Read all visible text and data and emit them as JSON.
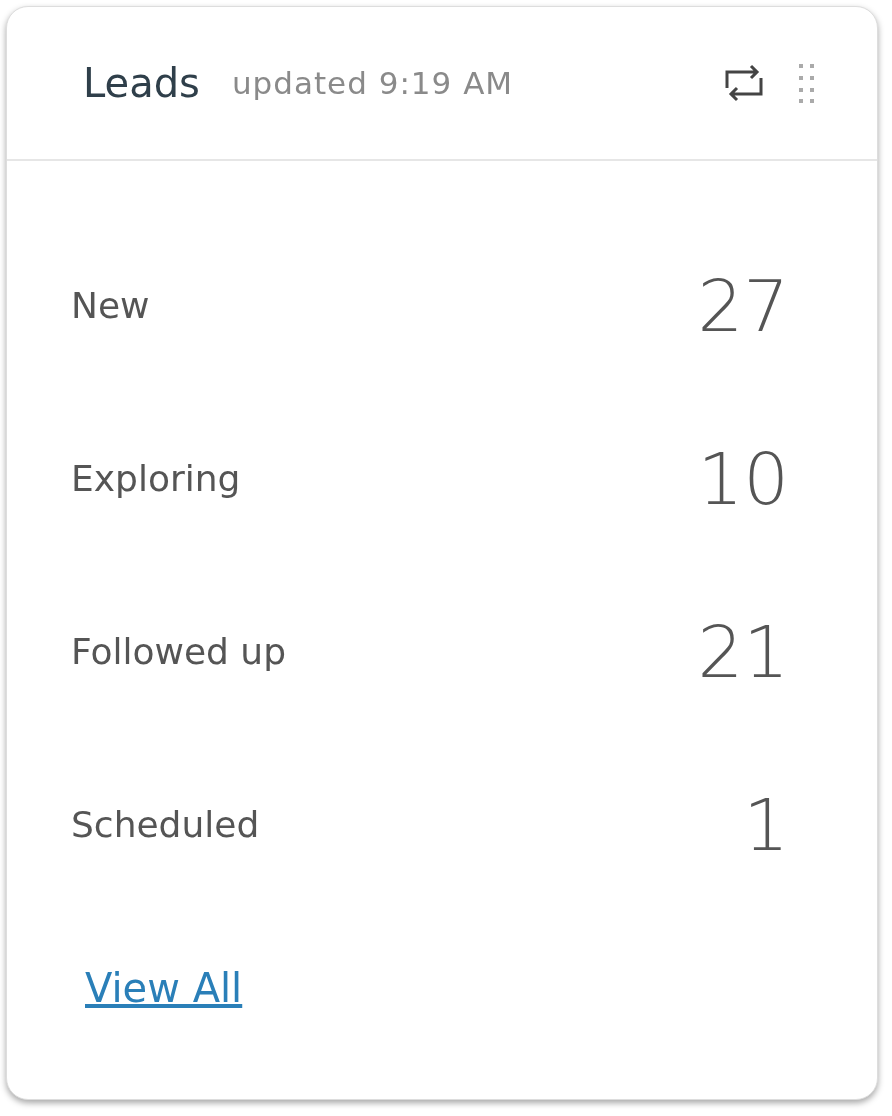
{
  "card": {
    "title": "Leads",
    "updated": "updated 9:19 AM"
  },
  "rows": [
    {
      "label": "New",
      "value": "27"
    },
    {
      "label": "Exploring",
      "value": "10"
    },
    {
      "label": "Followed up",
      "value": "21"
    },
    {
      "label": "Scheduled",
      "value": "1"
    }
  ],
  "link": "View All"
}
